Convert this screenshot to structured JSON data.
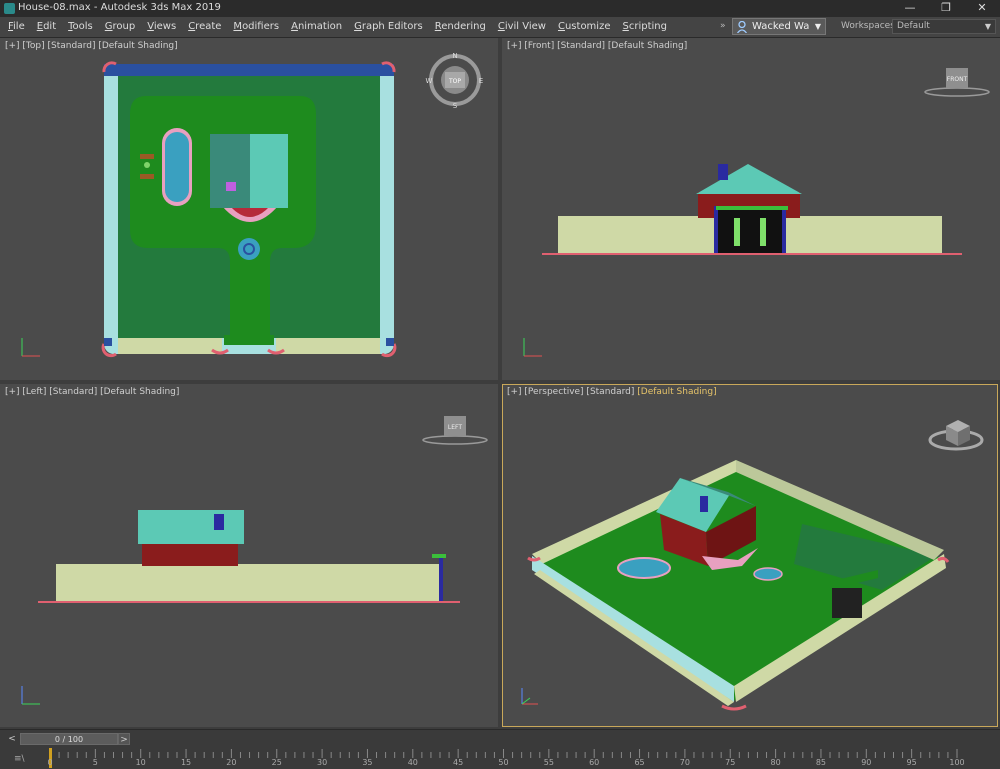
{
  "window": {
    "title": "House-08.max - Autodesk 3ds Max 2019",
    "controls": [
      "—",
      "❐",
      "✕"
    ]
  },
  "menubar": {
    "items": [
      "File",
      "Edit",
      "Tools",
      "Group",
      "Views",
      "Create",
      "Modifiers",
      "Animation",
      "Graph Editors",
      "Rendering",
      "Civil View",
      "Customize",
      "Scripting"
    ],
    "overflow": "»",
    "user": "Wacked Wa",
    "workspaces_label": "Workspaces:",
    "workspace_value": "Default"
  },
  "viewports": {
    "top": {
      "label": "[+] [Top] [Standard] [Default Shading]",
      "cube": "TOP",
      "compass": {
        "n": "N",
        "s": "S",
        "e": "E",
        "w": "W"
      }
    },
    "front": {
      "label": "[+] [Front] [Standard] [Default Shading]",
      "cube": "FRONT"
    },
    "left": {
      "label": "[+] [Left] [Standard] [Default Shading]",
      "cube": "LEFT"
    },
    "perspective": {
      "label_prefix": "[+] [Perspective] [Standard] ",
      "label_shading": "[Default Shading]"
    }
  },
  "timebar": {
    "frame_display": "0 / 100",
    "prev": "<",
    "next": ">"
  },
  "trackbar": {
    "corner": "≡\\",
    "ticks": [
      "0",
      "5",
      "10",
      "15",
      "20",
      "25",
      "30",
      "35",
      "40",
      "45",
      "50",
      "55",
      "60",
      "65",
      "70",
      "75",
      "80",
      "85",
      "90",
      "95",
      "100"
    ]
  },
  "colors": {
    "viewport_bg": "#4b4b4b",
    "active_border": "#c9a85a",
    "lawn": "#1e8b1e",
    "ground": "#237a3d",
    "wall": "#cfd9a6",
    "roof": "#5cc9b5",
    "house_body": "#8a1c1c",
    "pool": "#3aa0c0"
  }
}
